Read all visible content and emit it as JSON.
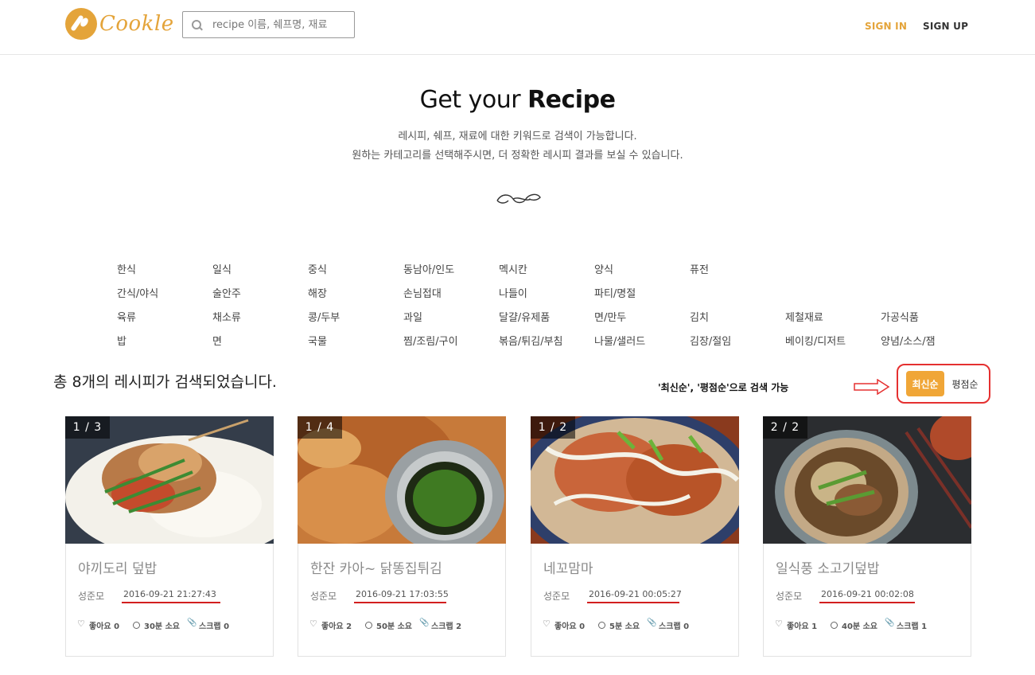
{
  "header": {
    "logo_text": "Cookle",
    "search_placeholder": "recipe 이름, 쉐프명, 재료",
    "signin": "SIGN IN",
    "signup": "SIGN UP"
  },
  "hero": {
    "title_prefix": "Get your ",
    "title_bold": "Recipe",
    "sub1": "레시피, 쉐프, 재료에 대한 키워드로 검색이 가능합니다.",
    "sub2": "원하는 카테고리를 선택해주시면, 더 정확한 레시피 결과를 보실 수 있습니다."
  },
  "categories": {
    "row1": [
      "한식",
      "일식",
      "중식",
      "동남아/인도",
      "멕시칸",
      "양식",
      "퓨전"
    ],
    "row2": [
      "간식/야식",
      "술안주",
      "해장",
      "손님접대",
      "나들이",
      "파티/명절"
    ],
    "row3": [
      "육류",
      "채소류",
      "콩/두부",
      "과일",
      "달걀/유제품",
      "면/만두",
      "김치",
      "제철재료",
      "가공식품"
    ],
    "row4": [
      "밥",
      "면",
      "국물",
      "찜/조림/구이",
      "볶음/튀김/부침",
      "나물/샐러드",
      "김장/절임",
      "베이킹/디저트",
      "양념/소스/잼"
    ]
  },
  "results": {
    "count_text": "총 8개의 레시피가 검색되었습니다.",
    "annotation": "'최신순', '평점순'으로 검색 가능",
    "sort_latest": "최신순",
    "sort_rating": "평점순"
  },
  "cards": [
    {
      "counter": "1 / 3",
      "title": "야끼도리 덮밥",
      "author": "성준모",
      "date": "2016-09-21 21:27:43",
      "likes": "좋아요 0",
      "time": "30분 소요",
      "scrap": "스크랩 0"
    },
    {
      "counter": "1 / 4",
      "title": "한잔 카아~ 닭똥집튀김",
      "author": "성준모",
      "date": "2016-09-21 17:03:55",
      "likes": "좋아요 2",
      "time": "50분 소요",
      "scrap": "스크랩 2"
    },
    {
      "counter": "1 / 2",
      "title": "네꼬맘마",
      "author": "성준모",
      "date": "2016-09-21 00:05:27",
      "likes": "좋아요 0",
      "time": "5분 소요",
      "scrap": "스크랩 0"
    },
    {
      "counter": "2 / 2",
      "title": "일식풍 소고기덮밥",
      "author": "성준모",
      "date": "2016-09-21 00:02:08",
      "likes": "좋아요 1",
      "time": "40분 소요",
      "scrap": "스크랩 1"
    }
  ],
  "colors": {
    "accent": "#e4a43a",
    "sort_active": "#f0a637",
    "annotation_red": "#e53030"
  },
  "icons": {
    "search": "search-icon",
    "like": "heart-icon",
    "time": "clock-icon",
    "scrap": "paperclip-icon"
  }
}
